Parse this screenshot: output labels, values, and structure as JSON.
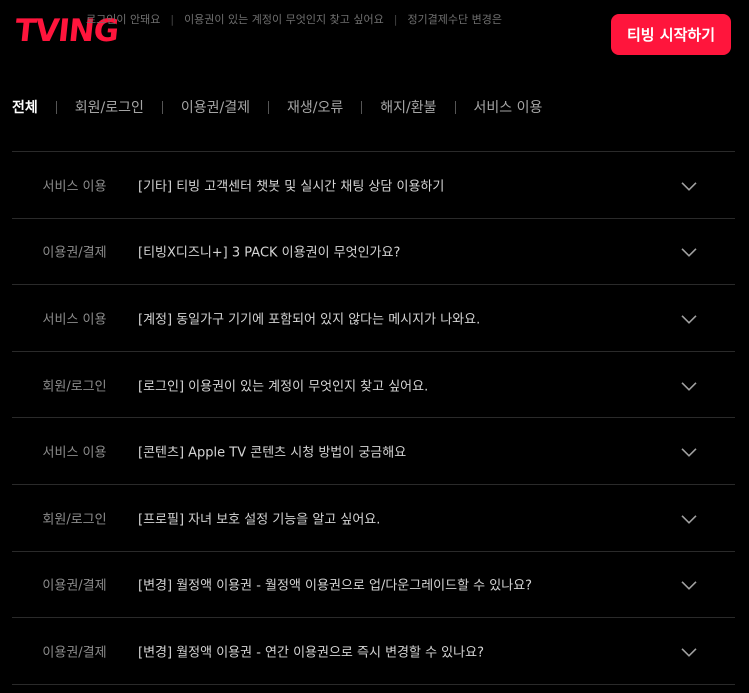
{
  "header": {
    "logo": "TVING",
    "ticker": [
      "로그인이 안돼요",
      "이용권이 있는 계정이 무엇인지 찾고 싶어요",
      "정기결제수단 변경은"
    ],
    "start_button": "티빙 시작하기"
  },
  "tabs": [
    {
      "label": "전체",
      "active": true
    },
    {
      "label": "회원/로그인",
      "active": false
    },
    {
      "label": "이용권/결제",
      "active": false
    },
    {
      "label": "재생/오류",
      "active": false
    },
    {
      "label": "해지/환불",
      "active": false
    },
    {
      "label": "서비스 이용",
      "active": false
    }
  ],
  "faq": [
    {
      "category": "서비스 이용",
      "question": "[기타] 티빙 고객센터 챗봇 및 실시간 채팅 상담 이용하기"
    },
    {
      "category": "이용권/결제",
      "question": "[티빙X디즈니+] 3 PACK 이용권이 무엇인가요?"
    },
    {
      "category": "서비스 이용",
      "question": "[계정] 동일가구 기기에 포함되어 있지 않다는 메시지가 나와요."
    },
    {
      "category": "회원/로그인",
      "question": "[로그인] 이용권이 있는 계정이 무엇인지 찾고 싶어요."
    },
    {
      "category": "서비스 이용",
      "question": "[콘텐츠] Apple TV 콘텐츠 시청 방법이 궁금해요"
    },
    {
      "category": "회원/로그인",
      "question": "[프로필] 자녀 보호 설정 기능을 알고 싶어요."
    },
    {
      "category": "이용권/결제",
      "question": "[변경] 월정액 이용권 - 월정액 이용권으로 업/다운그레이드할 수 있나요?"
    },
    {
      "category": "이용권/결제",
      "question": "[변경] 월정액 이용권 - 연간 이용권으로 즉시 변경할 수 있나요?"
    }
  ],
  "colors": {
    "accent": "#ff153c",
    "background": "#000000"
  },
  "icons": {
    "expand": "chevron-down-icon"
  }
}
